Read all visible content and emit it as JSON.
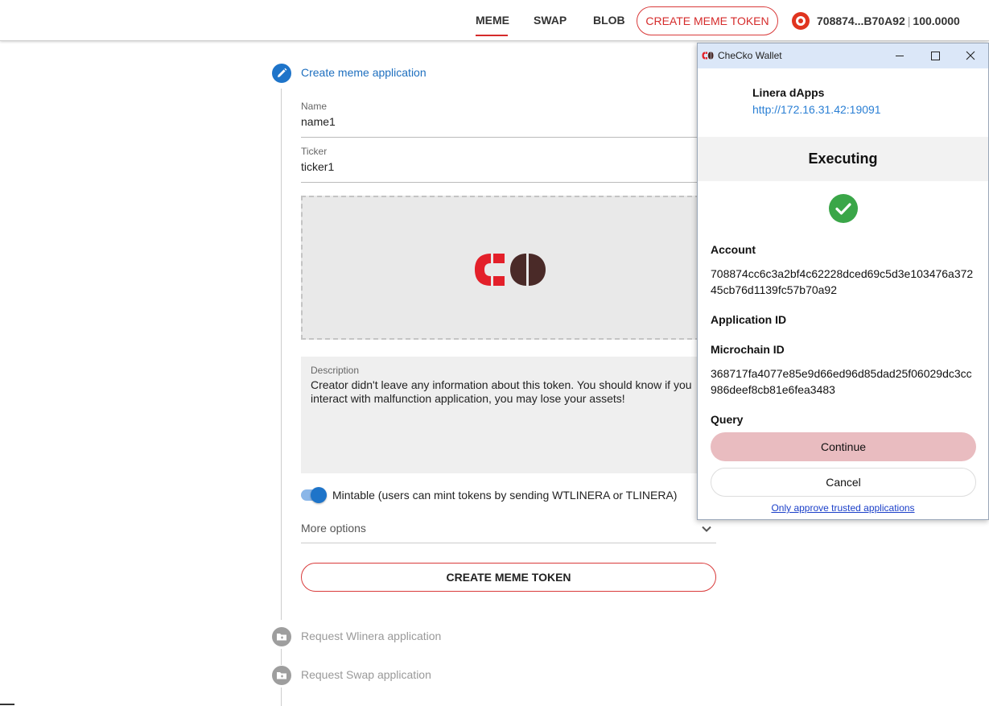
{
  "header": {
    "tabs": [
      {
        "label": "MEME",
        "active": true
      },
      {
        "label": "SWAP",
        "active": false
      },
      {
        "label": "BLOB",
        "active": false
      }
    ],
    "create_button": "CREATE MEME TOKEN",
    "account_short": "708874...B70A92",
    "balance": "100.0000",
    "account_icon": "account-icon"
  },
  "stepper": {
    "steps": [
      {
        "title": "Create meme application",
        "state": "active",
        "icon": "pencil-icon"
      },
      {
        "title": "Request Wlinera application",
        "state": "inactive",
        "icon": "folder-icon"
      },
      {
        "title": "Request Swap application",
        "state": "inactive",
        "icon": "folder-icon"
      }
    ]
  },
  "form": {
    "name_label": "Name",
    "name_value": "name1",
    "ticker_label": "Ticker",
    "ticker_value": "ticker1",
    "logo_icon": "checko-logo",
    "description_label": "Description",
    "description_value": "Creator didn't leave any information about this token. You should know if you interact with malfunction application, you may lose your assets!",
    "mintable_label": "Mintable (users can mint tokens by sending WTLINERA or TLINERA)",
    "mintable_on": true,
    "more_options": "More options",
    "submit_label": "CREATE MEME TOKEN"
  },
  "wallet": {
    "title": "CheCko Wallet",
    "dapp_name": "Linera dApps",
    "dapp_url": "http://172.16.31.42:19091",
    "status": "Executing",
    "status_icon": "check-circle-icon",
    "account_label": "Account",
    "account_value": "708874cc6c3a2bf4c62228dced69c5d3e103476a37245cb76d1139fc57b70a92",
    "application_id_label": "Application ID",
    "microchain_id_label": "Microchain ID",
    "microchain_id_value": "368717fa4077e85e9d66ed96d85dad25f06029dc3cc986deef8cb81e6fea3483",
    "query_label": "Query",
    "continue_label": "Continue",
    "cancel_label": "Cancel",
    "trusted_link": "Only approve trusted applications"
  },
  "colors": {
    "accent_red": "#d52b2b",
    "step_blue": "#1e74c9",
    "success_green": "#3aa648",
    "continue_pink": "#e9bcc0"
  }
}
